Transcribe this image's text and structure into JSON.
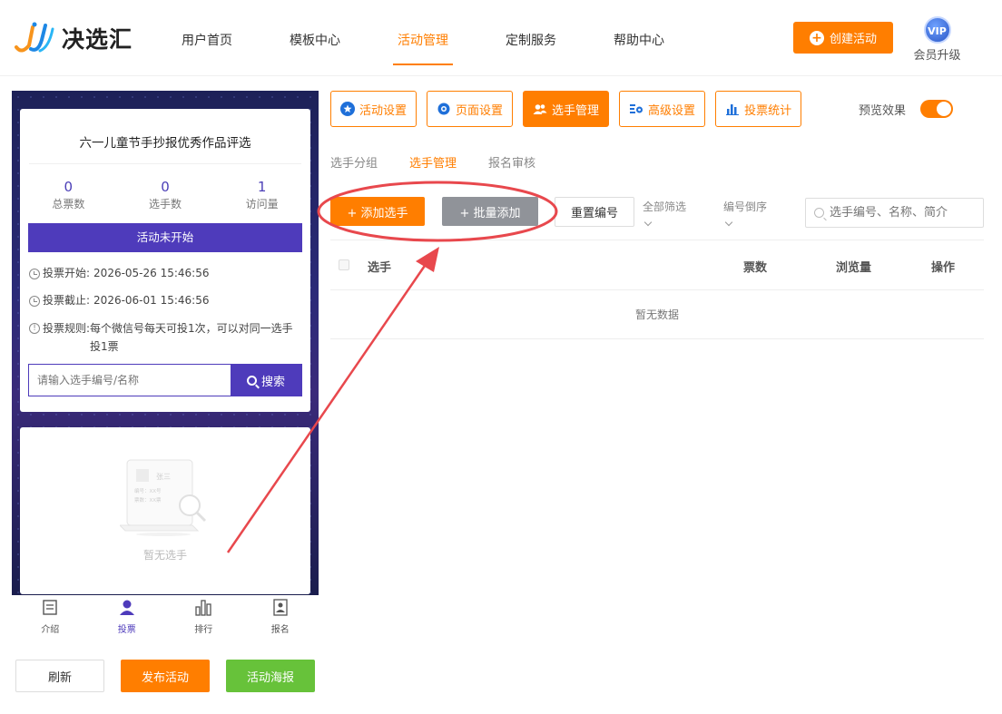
{
  "header": {
    "logo_text": "决选汇",
    "nav": [
      {
        "label": "用户首页",
        "active": false
      },
      {
        "label": "模板中心",
        "active": false
      },
      {
        "label": "活动管理",
        "active": true
      },
      {
        "label": "定制服务",
        "active": false
      },
      {
        "label": "帮助中心",
        "active": false
      }
    ],
    "create_label": "创建活动",
    "vip_badge": "VIP",
    "vip_label": "会员升级"
  },
  "preview": {
    "title": "六一儿童节手抄报优秀作品评选",
    "stats": [
      {
        "value": "0",
        "label": "总票数"
      },
      {
        "value": "0",
        "label": "选手数"
      },
      {
        "value": "1",
        "label": "访问量"
      }
    ],
    "status": "活动未开始",
    "vote_start_label": "投票开始:",
    "vote_start": "2026-05-26 15:46:56",
    "vote_end_label": "投票截止:",
    "vote_end": "2026-06-01 15:46:56",
    "rules_label": "投票规则:",
    "rules": "每个微信号每天可投1次，可以对同一选手投1票",
    "search_placeholder": "请输入选手编号/名称",
    "search_label": "搜索",
    "empty_text": "暂无选手",
    "illus_name": "张三",
    "illus_line1": "编号：XX号",
    "illus_line2": "票数：XX票",
    "tabs": [
      {
        "label": "介绍",
        "icon": "list-icon"
      },
      {
        "label": "投票",
        "icon": "user-icon"
      },
      {
        "label": "排行",
        "icon": "bar-chart-icon"
      },
      {
        "label": "报名",
        "icon": "badge-icon"
      }
    ]
  },
  "bottom_buttons": {
    "refresh": "刷新",
    "publish": "发布活动",
    "poster": "活动海报"
  },
  "toolbar": {
    "items": [
      {
        "label": "活动设置",
        "icon": "star-icon"
      },
      {
        "label": "页面设置",
        "icon": "gear-icon"
      },
      {
        "label": "选手管理",
        "icon": "users-icon"
      },
      {
        "label": "高级设置",
        "icon": "settings-list-icon"
      },
      {
        "label": "投票统计",
        "icon": "bar-chart-icon"
      }
    ],
    "preview_label": "预览效果",
    "preview_on": true
  },
  "subtabs": [
    {
      "label": "选手分组",
      "active": false
    },
    {
      "label": "选手管理",
      "active": true
    },
    {
      "label": "报名审核",
      "active": false
    }
  ],
  "actions": {
    "add": "+ 添加选手",
    "batch": "+ 批量添加",
    "renumber": "重置编号",
    "filter_all": "全部筛选",
    "sort": "编号倒序",
    "search_placeholder": "选手编号、名称、简介"
  },
  "table": {
    "columns": [
      "选手",
      "票数",
      "浏览量",
      "操作"
    ],
    "empty": "暂无数据"
  },
  "colors": {
    "accent": "#ff7e00",
    "purple": "#4e3bbb",
    "green": "#67c23a",
    "annotation": "#e8484d"
  }
}
